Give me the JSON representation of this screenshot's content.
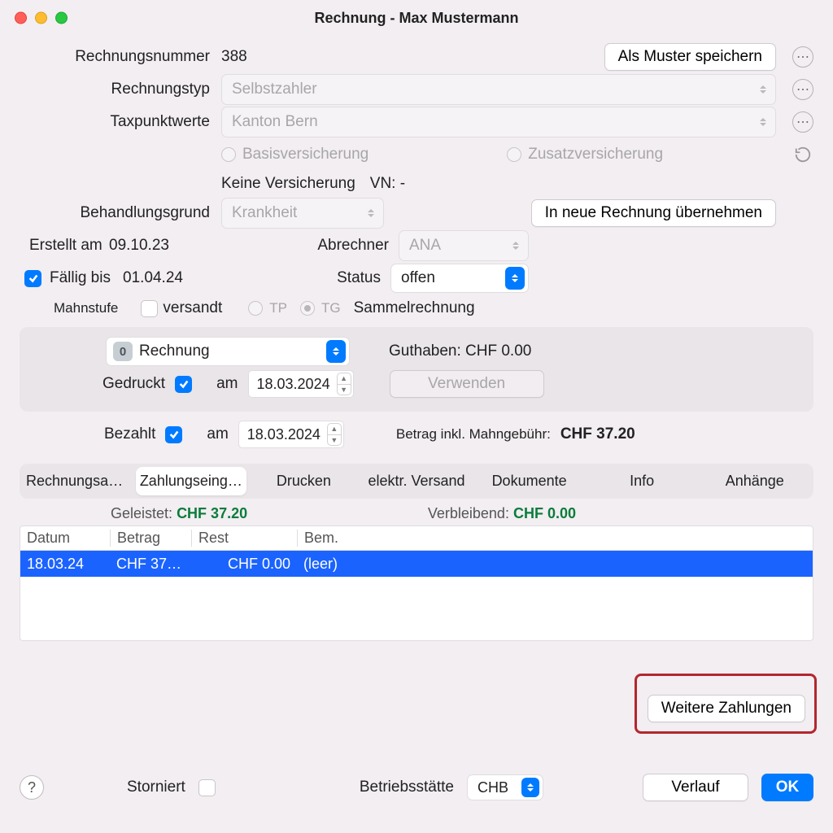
{
  "window": {
    "title": "Rechnung - Max Mustermann"
  },
  "labels": {
    "rechnungsnummer": "Rechnungsnummer",
    "rechnungstyp": "Rechnungstyp",
    "taxpunktwerte": "Taxpunktwerte",
    "behandlungsgrund": "Behandlungsgrund",
    "erstellt_am": "Erstellt am",
    "abrechner": "Abrechner",
    "faellig_bis": "Fällig bis",
    "status": "Status",
    "mahnstufe": "Mahnstufe",
    "versandt": "versandt",
    "tp": "TP",
    "tg": "TG",
    "sammelrechnung": "Sammelrechnung",
    "gedruckt": "Gedruckt",
    "am": "am",
    "bezahlt": "Bezahlt",
    "guthaben": "Guthaben: CHF 0.00",
    "verwenden": "Verwenden",
    "betrag_inkl": "Betrag inkl. Mahngebühr:",
    "betrag_inkl_value": "CHF 37.20",
    "storniert": "Storniert",
    "betriebsstaette": "Betriebsstätte",
    "verlauf": "Verlauf",
    "ok": "OK",
    "weitere_zahlungen": "Weitere Zahlungen",
    "als_muster": "Als Muster speichern",
    "in_neue": "In neue Rechnung übernehmen",
    "keine_versicherung": "Keine Versicherung",
    "vn": "VN: -",
    "basis": "Basisversicherung",
    "zusatz": "Zusatzversicherung",
    "geleistet": "Geleistet:",
    "verbleibend": "Verbleibend:"
  },
  "values": {
    "rechnungsnummer": "388",
    "rechnungstyp": "Selbstzahler",
    "taxpunktwerte": "Kanton Bern",
    "behandlungsgrund": "Krankheit",
    "erstellt_am": "09.10.23",
    "faellig_bis": "01.04.24",
    "abrechner": "ANA",
    "status": "offen",
    "mahnstufe_select": "Rechnung",
    "gedruckt_date": "18.03.2024",
    "bezahlt_date": "18.03.2024",
    "geleistet": "CHF 37.20",
    "verbleibend": "CHF 0.00",
    "betriebsstaette": "CHB"
  },
  "tabs": [
    "Rechnungsan…",
    "Zahlungseing…",
    "Drucken",
    "elektr. Versand",
    "Dokumente",
    "Info",
    "Anhänge"
  ],
  "active_tab": 1,
  "table": {
    "headers": [
      "Datum",
      "Betrag",
      "Rest",
      "Bem."
    ],
    "rows": [
      {
        "datum": "18.03.24",
        "betrag": "CHF 37.…",
        "rest": "CHF 0.00",
        "bem": "(leer)"
      }
    ]
  },
  "checks": {
    "faellig": true,
    "versandt": false,
    "gedruckt": true,
    "bezahlt": true,
    "storniert": false
  }
}
